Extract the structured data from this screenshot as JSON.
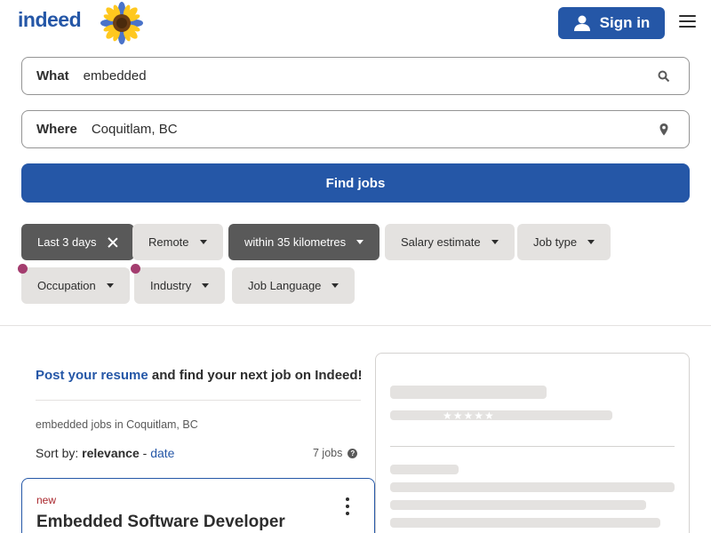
{
  "header": {
    "logo_text": "indeed",
    "signin_label": "Sign in",
    "colors": {
      "brand": "#2557a7"
    }
  },
  "search": {
    "what_label": "What",
    "what_value": "embedded",
    "where_label": "Where",
    "where_value": "Coquitlam, BC",
    "find_label": "Find jobs"
  },
  "filters": [
    {
      "label": "Last 3 days",
      "active": true,
      "icon": "close-icon"
    },
    {
      "label": "Remote",
      "active": false,
      "icon": "chevron-down-icon"
    },
    {
      "label": "within 35 kilometres",
      "active": true,
      "icon": "chevron-down-icon"
    },
    {
      "label": "Salary estimate",
      "active": false,
      "icon": "chevron-down-icon"
    },
    {
      "label": "Job type",
      "active": false,
      "icon": "chevron-down-icon"
    },
    {
      "label": "Occupation",
      "active": false,
      "icon": "chevron-down-icon",
      "badge": true
    },
    {
      "label": "Industry",
      "active": false,
      "icon": "chevron-down-icon",
      "badge": true
    },
    {
      "label": "Job Language",
      "active": false,
      "icon": "chevron-down-icon"
    }
  ],
  "results": {
    "post_link": "Post your resume",
    "post_rest": " and find your next job on Indeed!",
    "breadcrumb": "embedded jobs in Coquitlam, BC",
    "sort_prefix": "Sort by: ",
    "sort_relevance": "relevance",
    "sort_sep": " - ",
    "sort_date": "date",
    "count": "7 jobs"
  },
  "job_card": {
    "badge": "new",
    "title": "Embedded Software Developer"
  }
}
